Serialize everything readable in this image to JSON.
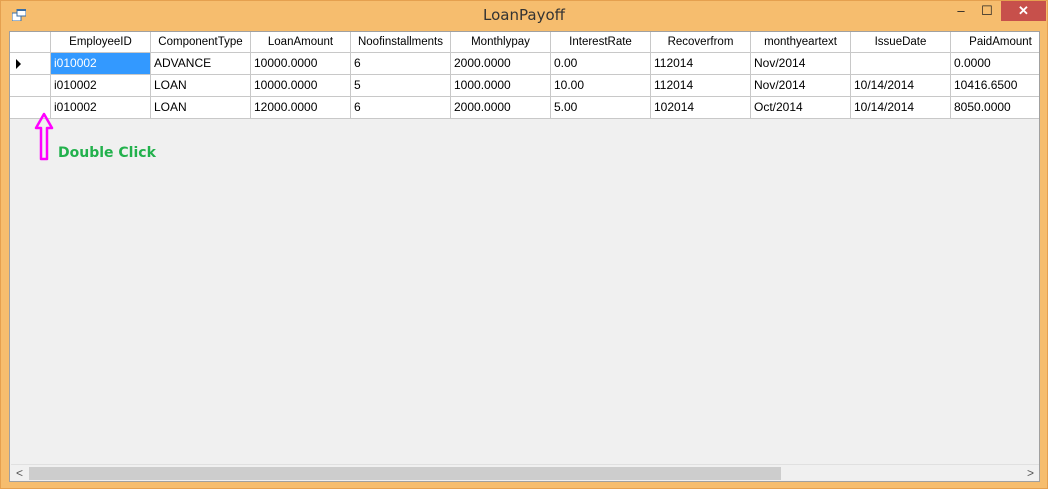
{
  "window": {
    "title": "LoanPayoff",
    "minimize": "‒",
    "maximize": "☐",
    "close": "✕"
  },
  "grid": {
    "columns": [
      "EmployeeID",
      "ComponentType",
      "LoanAmount",
      "Noofinstallments",
      "Monthlypay",
      "InterestRate",
      "Recoverfrom",
      "monthyeartext",
      "IssueDate",
      "PaidAmount"
    ],
    "rows": [
      [
        "i010002",
        "ADVANCE",
        "10000.0000",
        "6",
        "2000.0000",
        "0.00",
        "112014",
        "Nov/2014",
        "",
        "0.0000"
      ],
      [
        "i010002",
        "LOAN",
        "10000.0000",
        "5",
        "1000.0000",
        "10.00",
        "112014",
        "Nov/2014",
        "10/14/2014",
        "10416.6500"
      ],
      [
        "i010002",
        "LOAN",
        "12000.0000",
        "6",
        "2000.0000",
        "5.00",
        "102014",
        "Oct/2014",
        "10/14/2014",
        "8050.0000"
      ]
    ],
    "current_row": 0,
    "selected_cell": {
      "row": 0,
      "col": 0
    }
  },
  "annotation": {
    "label": "Double Click",
    "arrow_color": "#FF00FF",
    "label_color": "#22B14C"
  },
  "scrollbar": {
    "left": "<",
    "right": ">"
  },
  "colors": {
    "frame": "#F6BD6E",
    "selection": "#3399FF",
    "close_button": "#C7504B"
  }
}
